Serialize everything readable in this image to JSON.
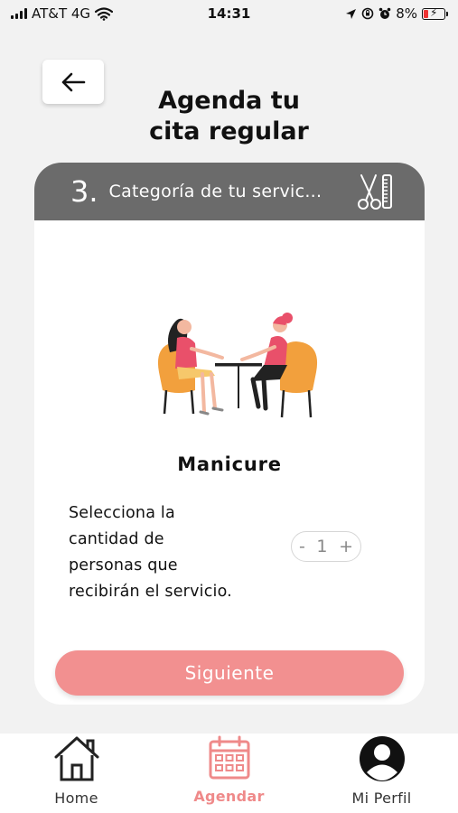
{
  "status_bar": {
    "carrier": "AT&T 4G",
    "time": "14:31",
    "battery": "8%"
  },
  "header": {
    "title_line1": "Agenda tu",
    "title_line2": "cita regular"
  },
  "step": {
    "number": "3.",
    "title": "Categoría de tu servic..."
  },
  "service": {
    "name": "Manicure",
    "quantity_prompt": "Selecciona la cantidad de personas que recibirán el servicio.",
    "quantity": "1",
    "minus": "-",
    "plus": "+"
  },
  "next_button": "Siguiente",
  "tabs": [
    {
      "label": "Home",
      "icon": "home-icon"
    },
    {
      "label": "Agendar",
      "icon": "calendar-icon"
    },
    {
      "label": "Mi Perfil",
      "icon": "profile-icon"
    }
  ],
  "colors": {
    "accent": "#f29090",
    "header_gray": "#6b6b6b",
    "chair_orange": "#f2a03d"
  }
}
